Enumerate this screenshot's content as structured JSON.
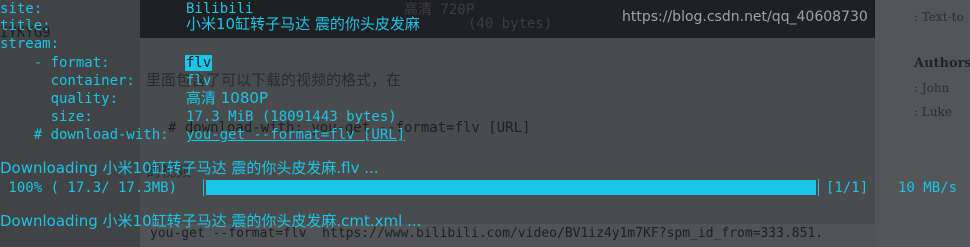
{
  "watermark": "https://blog.csdn.net/qq_40608730",
  "background": {
    "top_line_1": "高清 720P",
    "top_line_2": "(40 bytes)",
    "left_tag": "IYKYG9",
    "para": "里面包含了可以下载的视频的格式，在",
    "code_1": "# download-with: you-get --format=flv [URL]",
    "code_2": "的视频",
    "code_3": "you-get --format=flv  https://www.bilibili.com/video/BV1iz4y1m7KF?spm_id_from=333.851.",
    "sidebar_1": ": Text-to",
    "sidebar_authors": "Authors",
    "sidebar_john": ": John",
    "sidebar_luke": ": Luke"
  },
  "terminal": {
    "site_key": "site:",
    "site_val": "Bilibili",
    "title_key": "title:",
    "title_val": "小米10缸转子马达 震的你头皮发麻",
    "stream_key": "stream:",
    "format_key": "    - format:",
    "format_val": "flv",
    "container_key": "      container:",
    "container_val": "flv",
    "quality_key": "      quality:",
    "quality_val": "高清 1080P",
    "size_key": "      size:",
    "size_val": "17.3 MiB (18091443 bytes)",
    "download_key": "    # download-with:",
    "download_val": "you-get --format=flv [URL]",
    "downloading_1": "Downloading 小米10缸转子马达 震的你头皮发麻.flv ...",
    "progress_left": " 100% ( 17.3/ 17.3MB) ",
    "progress_count": "[1/1]",
    "progress_speed": "10 MB/s",
    "downloading_2": "Downloading 小米10缸转子马达 震的你头皮发麻.cmt.xml ..."
  },
  "progress": {
    "percent": 100
  },
  "colors": {
    "terminal_accent": "#19c6e8",
    "background": "#3a3b3d"
  }
}
